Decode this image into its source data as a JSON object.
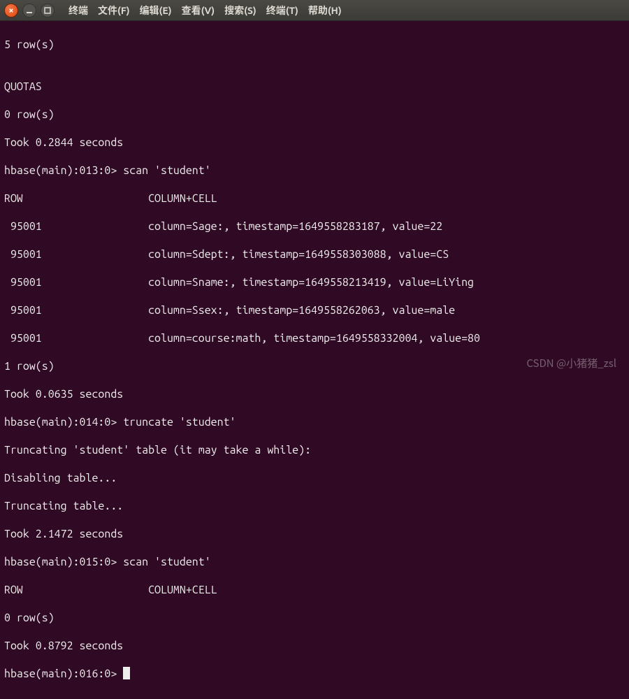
{
  "window": {
    "close_label": "×",
    "minimize_label": "–",
    "maximize_label": "☐"
  },
  "menu": {
    "terminal_left": "终端",
    "file": "文件(F)",
    "edit": "编辑(E)",
    "view": "查看(V)",
    "search": "搜索(S)",
    "terminal": "终端(T)",
    "help": "帮助(H)"
  },
  "lines": {
    "l0": "5 row(s)",
    "l1": "",
    "l2": "QUOTAS",
    "l3": "0 row(s)",
    "l4": "Took 0.2844 seconds",
    "l5": "hbase(main):013:0> scan 'student'",
    "l6": "ROW                    COLUMN+CELL",
    "l7": " 95001                 column=Sage:, timestamp=1649558283187, value=22",
    "l8": " 95001                 column=Sdept:, timestamp=1649558303088, value=CS",
    "l9": " 95001                 column=Sname:, timestamp=1649558213419, value=LiYing",
    "l10": " 95001                 column=Ssex:, timestamp=1649558262063, value=male",
    "l11": " 95001                 column=course:math, timestamp=1649558332004, value=80",
    "l12": "1 row(s)",
    "l13": "Took 0.0635 seconds",
    "l14": "hbase(main):014:0> truncate 'student'",
    "l15": "Truncating 'student' table (it may take a while):",
    "l16": "Disabling table...",
    "l17": "Truncating table...",
    "l18": "Took 2.1472 seconds",
    "l19": "hbase(main):015:0> scan 'student'",
    "l20": "ROW                    COLUMN+CELL",
    "l21": "0 row(s)",
    "l22": "Took 0.8792 seconds",
    "l23": "hbase(main):016:0> "
  },
  "watermark": "CSDN @小猪猪_zsl"
}
